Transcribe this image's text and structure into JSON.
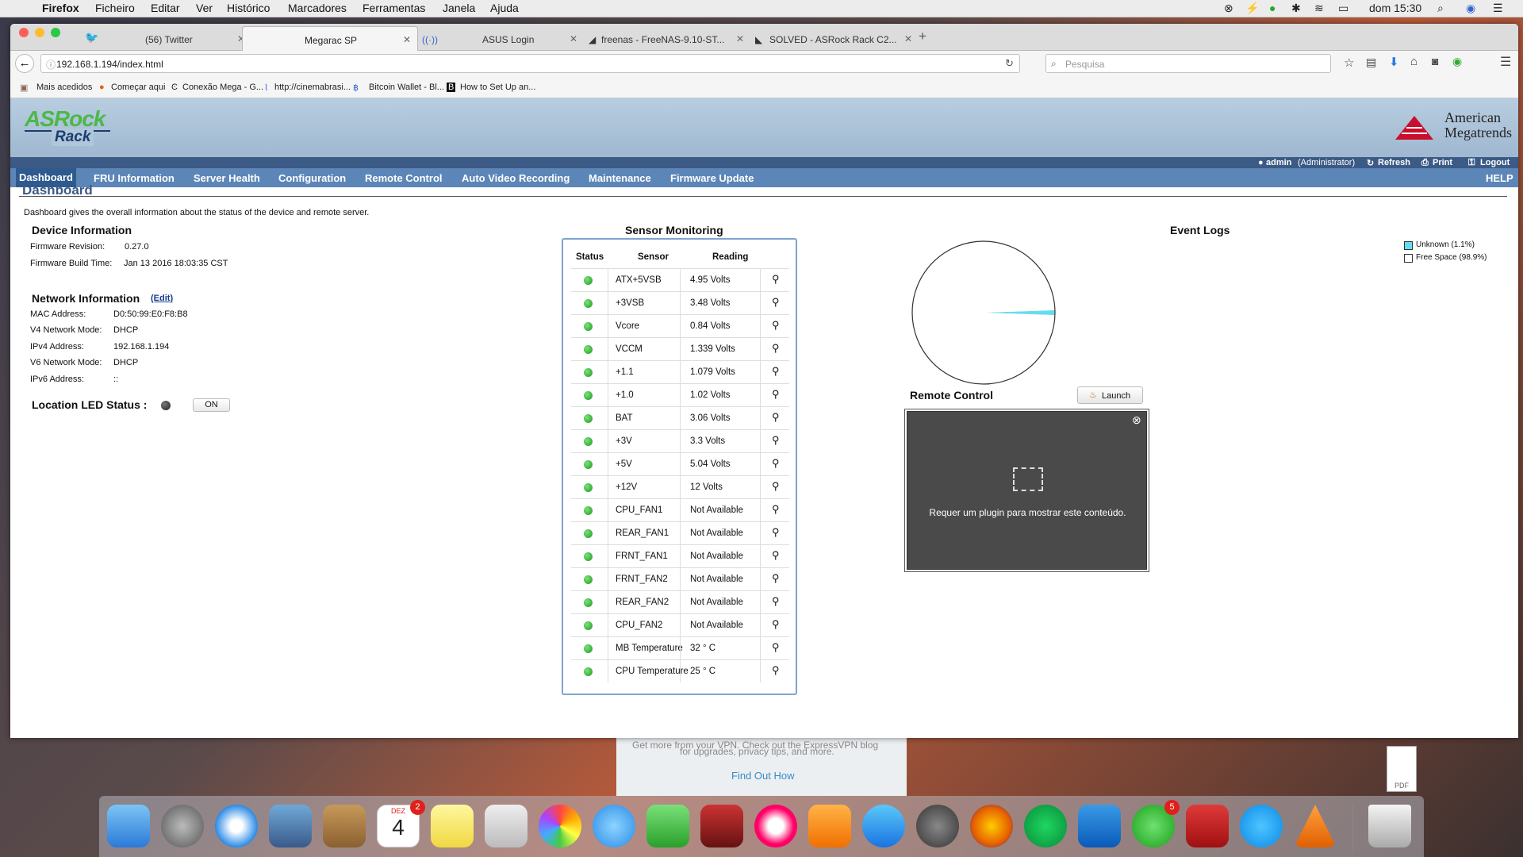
{
  "menubar": {
    "app": "Firefox",
    "items": [
      "Ficheiro",
      "Editar",
      "Ver",
      "Histórico",
      "Marcadores",
      "Ferramentas",
      "Janela",
      "Ajuda"
    ],
    "clock": "dom 15:30"
  },
  "tabs": [
    {
      "label": "(56) Twitter",
      "icon": "twitter-icon"
    },
    {
      "label": "Megarac SP",
      "icon": "none"
    },
    {
      "label": "ASUS Login",
      "icon": "wireless-icon"
    },
    {
      "label": "freenas - FreeNAS-9.10-ST...",
      "icon": "freenas-icon"
    },
    {
      "label": "SOLVED - ASRock Rack C2...",
      "icon": "asrock-icon"
    }
  ],
  "browser": {
    "url": "192.168.1.194/index.html",
    "search_placeholder": "Pesquisa"
  },
  "bookmarks": [
    "Mais acedidos",
    "Começar aqui",
    "Conexão Mega - G...",
    "http://cinemabrasi...",
    "Bitcoin Wallet - Bl...",
    "How to Set Up an..."
  ],
  "page": {
    "logo_top": "ASRock",
    "logo_bottom": "Rack",
    "vendor_line1": "American",
    "vendor_line2": "Megatrends",
    "user": "admin",
    "role": "(Administrator)",
    "refresh": "Refresh",
    "print": "Print",
    "logout": "Logout",
    "nav": [
      "Dashboard",
      "FRU Information",
      "Server Health",
      "Configuration",
      "Remote Control",
      "Auto Video Recording",
      "Maintenance",
      "Firmware Update"
    ],
    "help": "HELP",
    "title": "Dashboard",
    "intro": "Dashboard gives the overall information about the status of the device and remote server.",
    "device": {
      "heading": "Device Information",
      "fw_rev_label": "Firmware Revision:",
      "fw_rev": "0.27.0",
      "fw_build_label": "Firmware Build Time:",
      "fw_build": "Jan 13 2016 18:03:35 CST"
    },
    "network": {
      "heading": "Network Information",
      "edit": "(Edit)",
      "rows": [
        {
          "label": "MAC Address:",
          "value": "D0:50:99:E0:F8:B8"
        },
        {
          "label": "V4 Network Mode:",
          "value": "DHCP"
        },
        {
          "label": "IPv4 Address:",
          "value": "192.168.1.194"
        },
        {
          "label": "V6 Network Mode:",
          "value": "DHCP"
        },
        {
          "label": "IPv6 Address:",
          "value": "::"
        }
      ]
    },
    "led": {
      "label": "Location LED Status :",
      "button": "ON"
    },
    "sensors": {
      "heading": "Sensor Monitoring",
      "col_status": "Status",
      "col_sensor": "Sensor",
      "col_reading": "Reading",
      "rows": [
        {
          "name": "ATX+5VSB",
          "reading": "4.95 Volts"
        },
        {
          "name": "+3VSB",
          "reading": "3.48 Volts"
        },
        {
          "name": "Vcore",
          "reading": "0.84 Volts"
        },
        {
          "name": "VCCM",
          "reading": "1.339 Volts"
        },
        {
          "name": "+1.1",
          "reading": "1.079 Volts"
        },
        {
          "name": "+1.0",
          "reading": "1.02 Volts"
        },
        {
          "name": "BAT",
          "reading": "3.06 Volts"
        },
        {
          "name": "+3V",
          "reading": "3.3 Volts"
        },
        {
          "name": "+5V",
          "reading": "5.04 Volts"
        },
        {
          "name": "+12V",
          "reading": "12 Volts"
        },
        {
          "name": "CPU_FAN1",
          "reading": "Not Available"
        },
        {
          "name": "REAR_FAN1",
          "reading": "Not Available"
        },
        {
          "name": "FRNT_FAN1",
          "reading": "Not Available"
        },
        {
          "name": "FRNT_FAN2",
          "reading": "Not Available"
        },
        {
          "name": "REAR_FAN2",
          "reading": "Not Available"
        },
        {
          "name": "CPU_FAN2",
          "reading": "Not Available"
        },
        {
          "name": "MB Temperature",
          "reading": "32 ° C"
        },
        {
          "name": "CPU Temperature",
          "reading": "25 ° C"
        }
      ]
    },
    "events": {
      "heading": "Event Logs",
      "legend": [
        {
          "label": "Unknown (1.1%)",
          "color": "#66ddee"
        },
        {
          "label": "Free Space (98.9%)",
          "color": "#ffffff"
        }
      ]
    },
    "remote": {
      "heading": "Remote Control",
      "launch": "Launch",
      "plugin_msg": "Requer um plugin para mostrar este conteúdo."
    }
  },
  "behind": {
    "line1": "Get more from your VPN. Check out the ExpressVPN blog",
    "line2": "for upgrades, privacy tips, and more.",
    "link": "Find Out How",
    "pdf": "PDF"
  },
  "dock": {
    "calendar_month": "DEZ",
    "calendar_day": "4",
    "calendar_badge": "2",
    "messages_badge": "5"
  },
  "chart_data": {
    "type": "pie",
    "categories": [
      "Unknown",
      "Free Space"
    ],
    "values": [
      1.1,
      98.9
    ],
    "colors": [
      "#66ddee",
      "#ffffff"
    ]
  }
}
